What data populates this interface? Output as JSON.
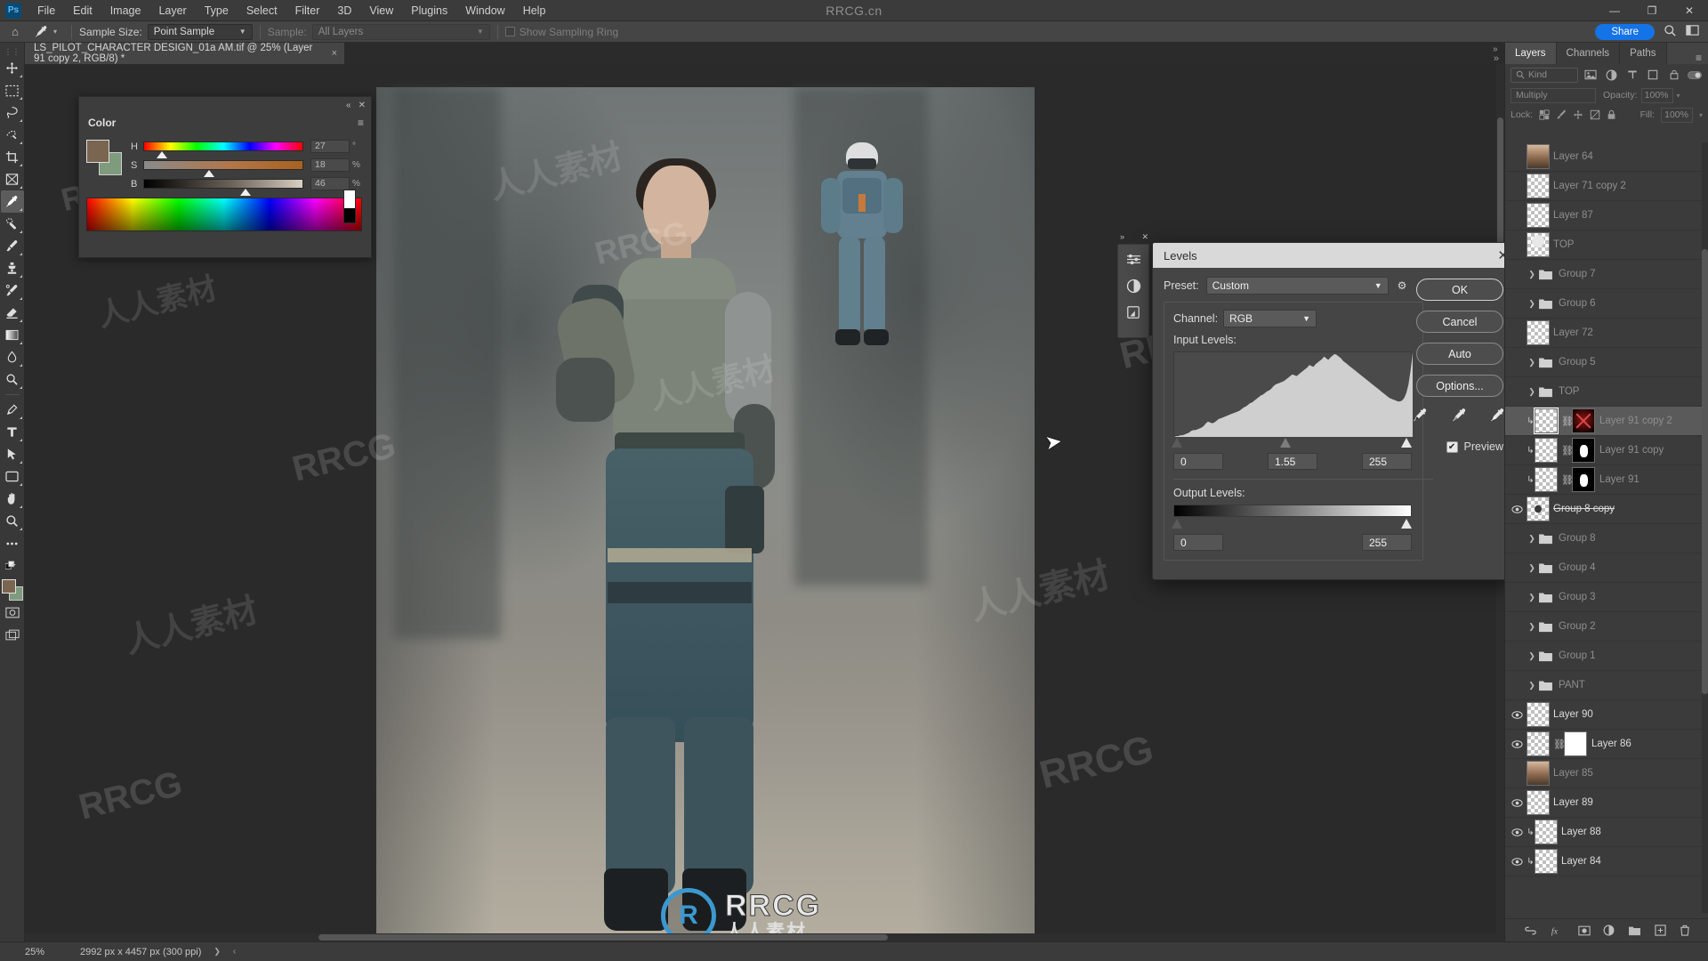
{
  "app": {
    "name": "Adobe Photoshop",
    "logo_text": "Ps",
    "watermark_top": "RRCG.cn"
  },
  "menubar": {
    "items": [
      "File",
      "Edit",
      "Image",
      "Layer",
      "Type",
      "Select",
      "Filter",
      "3D",
      "View",
      "Plugins",
      "Window",
      "Help"
    ],
    "window_controls": {
      "minimize": "—",
      "maximize": "❐",
      "close": "✕"
    }
  },
  "options_bar": {
    "home_icon": "home-icon",
    "tool_icon": "eyedropper-icon",
    "sample_size_label": "Sample Size:",
    "sample_size_value": "Point Sample",
    "sample_label": "Sample:",
    "sample_value": "All Layers",
    "show_sampling_ring_label": "Show Sampling Ring",
    "show_sampling_ring_checked": false
  },
  "titlebar_right": {
    "share_label": "Share",
    "search_icon": "search-icon",
    "workspace_icon": "workspace-panel-icon"
  },
  "document_tab": {
    "title": "LS_PILOT_CHARACTER DESIGN_01a AM.tif @ 25% (Layer 91 copy 2, RGB/8) *",
    "close_icon": "×"
  },
  "toolbar": {
    "tools": [
      {
        "name": "move-tool",
        "icon": "move-icon",
        "active": false
      },
      {
        "name": "rectangular-marquee-tool",
        "icon": "marquee-icon",
        "active": false
      },
      {
        "name": "lasso-tool",
        "icon": "lasso-icon",
        "active": false
      },
      {
        "name": "object-selection-tool",
        "icon": "quick-select-icon",
        "active": false
      },
      {
        "name": "crop-tool",
        "icon": "crop-icon",
        "active": false
      },
      {
        "name": "frame-tool",
        "icon": "frame-icon",
        "active": false
      },
      {
        "name": "eyedropper-tool",
        "icon": "eyedropper-icon",
        "active": true
      },
      {
        "name": "spot-healing-brush-tool",
        "icon": "healing-icon",
        "active": false
      },
      {
        "name": "brush-tool",
        "icon": "brush-icon",
        "active": false
      },
      {
        "name": "clone-stamp-tool",
        "icon": "stamp-icon",
        "active": false
      },
      {
        "name": "history-brush-tool",
        "icon": "history-brush-icon",
        "active": false
      },
      {
        "name": "eraser-tool",
        "icon": "eraser-icon",
        "active": false
      },
      {
        "name": "gradient-tool",
        "icon": "gradient-icon",
        "active": false
      },
      {
        "name": "blur-tool",
        "icon": "blur-icon",
        "active": false
      },
      {
        "name": "dodge-tool",
        "icon": "dodge-icon",
        "active": false
      },
      {
        "name": "pen-tool",
        "icon": "pen-icon",
        "active": false
      },
      {
        "name": "type-tool",
        "icon": "type-icon",
        "active": false
      },
      {
        "name": "path-selection-tool",
        "icon": "path-arrow-icon",
        "active": false
      },
      {
        "name": "rectangle-tool",
        "icon": "rectangle-icon",
        "active": false
      },
      {
        "name": "hand-tool",
        "icon": "hand-icon",
        "active": false
      },
      {
        "name": "zoom-tool",
        "icon": "magnifier-icon",
        "active": false
      },
      {
        "name": "edit-toolbar",
        "icon": "ellipsis-icon",
        "active": false
      }
    ],
    "foreground_color": "#7a6550",
    "background_color": "#7e9b7e",
    "quick_mask_icon": "quick-mask-icon",
    "screen_mode_icon": "screen-mode-icon"
  },
  "color_panel": {
    "title": "Color",
    "collapse_icon": "«",
    "close_icon": "✕",
    "menu_icon": "panel-menu-icon",
    "sliders": [
      {
        "label": "H",
        "value": "27",
        "unit": "°",
        "thumb_pct": 11
      },
      {
        "label": "S",
        "value": "18",
        "unit": "%",
        "thumb_pct": 41
      },
      {
        "label": "B",
        "value": "46",
        "unit": "%",
        "thumb_pct": 64
      }
    ],
    "foreground_color": "#7a6550",
    "background_color": "#7e9b7e"
  },
  "levels_dialog": {
    "title": "Levels",
    "close_icon": "✕",
    "preset_label": "Preset:",
    "preset_value": "Custom",
    "gear_icon": "gear-icon",
    "channel_label": "Channel:",
    "channel_value": "RGB",
    "input_levels_label": "Input Levels:",
    "input_shadow": "0",
    "input_gamma": "1.55",
    "input_highlight": "255",
    "output_levels_label": "Output Levels:",
    "output_shadow": "0",
    "output_highlight": "255",
    "buttons": [
      {
        "name": "ok-button",
        "label": "OK"
      },
      {
        "name": "cancel-button",
        "label": "Cancel"
      },
      {
        "name": "auto-button",
        "label": "Auto"
      },
      {
        "name": "options-button",
        "label": "Options..."
      }
    ],
    "eyedroppers": [
      "set-black-point-eyedropper",
      "set-gray-point-eyedropper",
      "set-white-point-eyedropper"
    ],
    "preview_label": "Preview",
    "preview_checked": true,
    "histogram": "0,1,1,2,2,3,4,5,7,8,8,9,10,11,13,16,18,17,16,17,19,21,22,23,24,25,26,27,28,29,30,31,33,35,36,38,40,41,43,45,47,49,50,52,54,55,57,60,62,63,64,65,66,68,70,72,74,73,72,74,76,78,80,82,85,84,83,86,88,90,92,95,93,91,94,96,98,97,95,93,90,88,86,84,82,80,78,76,74,72,70,68,66,64,62,60,58,56,54,52,50,48,46,45,44,43,42,42,43,46,52,62,78,100"
  },
  "layers_panel": {
    "tabs": [
      {
        "name": "tab-layers",
        "label": "Layers",
        "active": true
      },
      {
        "name": "tab-channels",
        "label": "Channels",
        "active": false
      },
      {
        "name": "tab-paths",
        "label": "Paths",
        "active": false
      }
    ],
    "menu_icon": "panel-menu-icon",
    "filter": {
      "search_icon": "search-icon",
      "kind_label": "Kind",
      "filter_icons": [
        "pixel-filter-icon",
        "adjustment-filter-icon",
        "type-filter-icon",
        "shape-filter-icon",
        "smart-object-filter-icon",
        "toggle-filter-icon"
      ]
    },
    "blend_mode": "Multiply",
    "opacity_label": "Opacity:",
    "opacity_value": "100%",
    "lock_label": "Lock:",
    "lock_icons": [
      "lock-transparency-icon",
      "lock-pixels-icon",
      "lock-position-icon",
      "lock-artboard-icon",
      "lock-all-icon"
    ],
    "fill_label": "Fill:",
    "fill_value": "100%",
    "layers": [
      {
        "name": "Layer 64",
        "type": "pixel",
        "visible": false,
        "selected": false,
        "thumb": "portrait"
      },
      {
        "name": "Layer 71 copy 2",
        "type": "pixel",
        "visible": false,
        "selected": false,
        "thumb": "empty"
      },
      {
        "name": "Layer 87",
        "type": "pixel",
        "visible": false,
        "selected": false,
        "thumb": "empty"
      },
      {
        "name": "TOP",
        "type": "pixel",
        "visible": false,
        "selected": false,
        "thumb": "helmet"
      },
      {
        "name": "Group 7",
        "type": "group",
        "visible": false,
        "selected": false
      },
      {
        "name": "Group 6",
        "type": "group",
        "visible": false,
        "selected": false
      },
      {
        "name": "Layer 72",
        "type": "pixel",
        "visible": false,
        "selected": false,
        "thumb": "empty"
      },
      {
        "name": "Group 5",
        "type": "group",
        "visible": false,
        "selected": false
      },
      {
        "name": "TOP",
        "type": "group",
        "visible": false,
        "selected": false
      },
      {
        "name": "Layer 91 copy 2",
        "type": "pixel-mask",
        "visible": false,
        "selected": true,
        "mask": "red",
        "clipped": true
      },
      {
        "name": "Layer 91 copy",
        "type": "pixel-mask",
        "visible": false,
        "selected": false,
        "mask": "black",
        "clipped": true
      },
      {
        "name": "Layer 91",
        "type": "pixel-mask",
        "visible": false,
        "selected": false,
        "mask": "black",
        "clipped": true
      },
      {
        "name": "Group 8 copy",
        "type": "pixel",
        "visible": true,
        "selected": false,
        "thumb": "figure",
        "strike": true
      },
      {
        "name": "Group 8",
        "type": "group",
        "visible": false,
        "selected": false
      },
      {
        "name": "Group 4",
        "type": "group",
        "visible": false,
        "selected": false
      },
      {
        "name": "Group 3",
        "type": "group",
        "visible": false,
        "selected": false
      },
      {
        "name": "Group 2",
        "type": "group",
        "visible": false,
        "selected": false
      },
      {
        "name": "Group 1",
        "type": "group",
        "visible": false,
        "selected": false
      },
      {
        "name": "PANT",
        "type": "group",
        "visible": false,
        "selected": false
      },
      {
        "name": "Layer 90",
        "type": "pixel",
        "visible": true,
        "selected": false,
        "thumb": "empty"
      },
      {
        "name": "Layer 86",
        "type": "pixel-mask",
        "visible": true,
        "selected": false,
        "mask": "white"
      },
      {
        "name": "Layer 85",
        "type": "pixel",
        "visible": false,
        "selected": false,
        "thumb": "portrait"
      },
      {
        "name": "Layer 89",
        "type": "pixel",
        "visible": true,
        "selected": false,
        "thumb": "empty"
      },
      {
        "name": "Layer 88",
        "type": "pixel",
        "visible": true,
        "selected": false,
        "thumb": "empty",
        "clipped": true
      },
      {
        "name": "Layer 84",
        "type": "pixel",
        "visible": true,
        "selected": false,
        "thumb": "empty",
        "clipped": true
      }
    ],
    "footer_icons": [
      "link-layers-icon",
      "layer-style-icon",
      "add-mask-icon",
      "adjustment-layer-icon",
      "new-group-icon",
      "new-layer-icon",
      "delete-layer-icon"
    ]
  },
  "canvas_mini_panel": {
    "icons": [
      "properties-sliders-icon",
      "adjustments-icon",
      "new-adjustment-layer-icon"
    ],
    "expand_icon": "»",
    "close_icon": "✕"
  },
  "status_bar": {
    "zoom": "25%",
    "dimensions": "2992 px x 4457 px (300 ppi)",
    "caret_icon": "chevron-right-icon",
    "arrows_icon": "nav-arrows-icon"
  },
  "watermarks": {
    "rrcg_main": "RRCG",
    "rrcg_sub": "人人素材",
    "rrcg_mark": "R",
    "texts": [
      "RRCG",
      "人人素材"
    ]
  }
}
